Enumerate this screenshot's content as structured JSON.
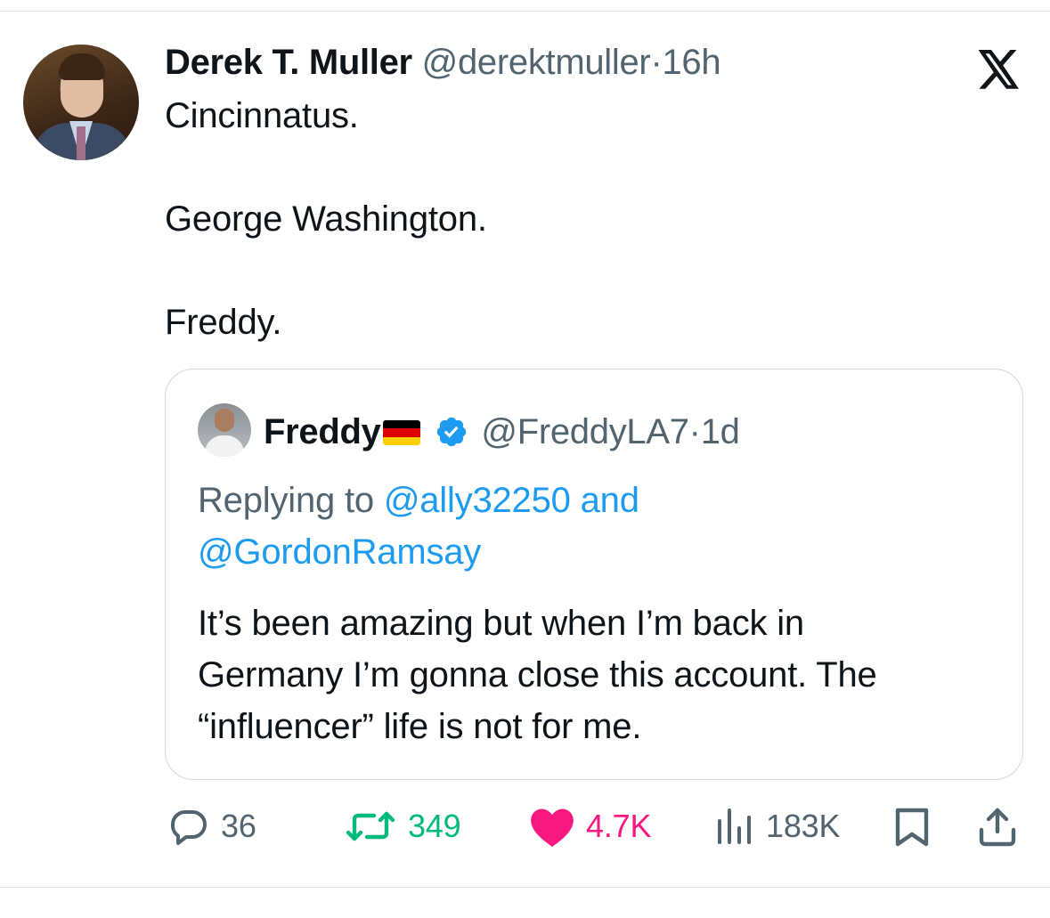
{
  "tweet": {
    "author_name": "Derek T. Muller",
    "author_handle": "@derektmuller",
    "separator": "·",
    "time": "16h",
    "lines": [
      "Cincinnatus.",
      "George Washington.",
      "Freddy."
    ]
  },
  "quote": {
    "author_name": "Freddy",
    "author_handle": "@FreddyLA7",
    "separator": "·",
    "time": "1d",
    "replying_prefix": "Replying to",
    "reply_to_1": "@ally32250",
    "reply_and": "and",
    "reply_to_2": "@GordonRamsay",
    "body_lines": [
      "It’s been amazing but when I’m back in",
      "Germany I’m gonna close this account. The",
      "“influencer” life is not for me."
    ]
  },
  "actions": {
    "replies": "36",
    "retweets": "349",
    "likes": "4.7K",
    "views": "183K"
  },
  "icons": {
    "logo": "x-logo-icon",
    "verified": "verified-badge-icon",
    "flag": "germany-flag-icon",
    "reply": "reply-icon",
    "retweet": "retweet-icon",
    "like": "heart-icon",
    "views": "views-icon",
    "bookmark": "bookmark-icon",
    "share": "share-icon"
  },
  "colors": {
    "link": "#1d9bf0",
    "muted": "#536471",
    "retweet": "#00ba7c",
    "like": "#f91880",
    "verified": "#1d9bf0",
    "flag": [
      "#000000",
      "#dd0000",
      "#ffce00"
    ]
  }
}
